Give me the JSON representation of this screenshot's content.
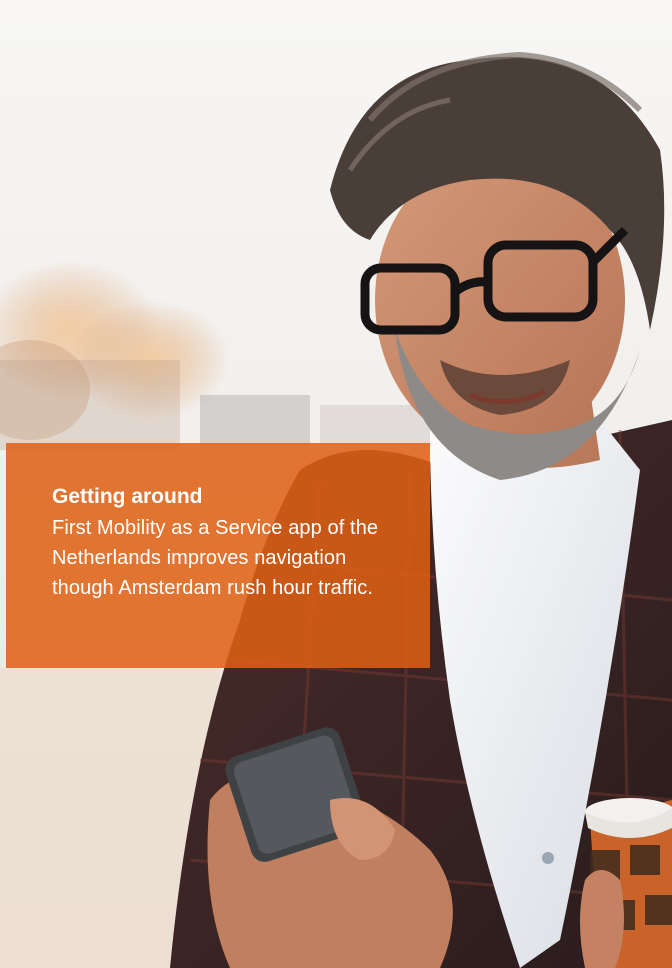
{
  "card": {
    "title": "Getting around",
    "body": "First Mobility as a Service app of the Netherlands improves navigation though Amsterdam rush hour traffic."
  },
  "colors": {
    "overlay": "#e06014",
    "background": "#f6f5f3"
  }
}
